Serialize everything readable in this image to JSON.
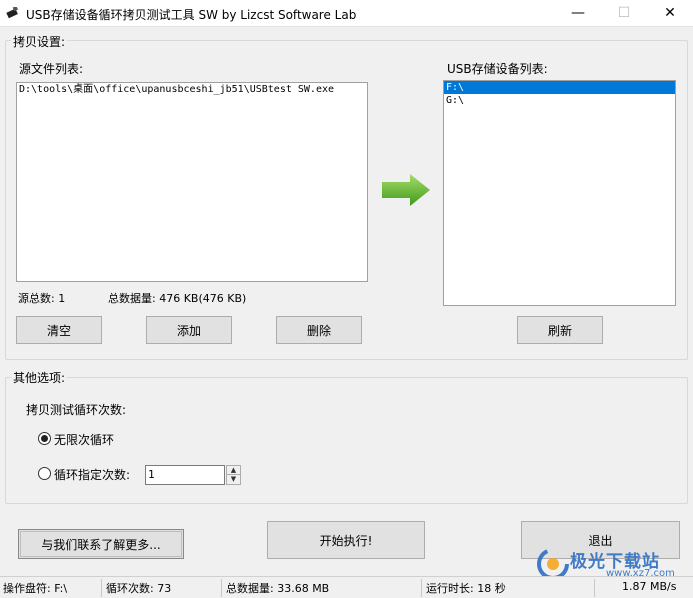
{
  "window": {
    "title": "USB存储设备循环拷贝测试工具 SW  by Lizcst Software Lab",
    "minimize_glyph": "—",
    "maximize_glyph": "☐",
    "close_glyph": "✕"
  },
  "copy_settings": {
    "group_label": "拷贝设置:",
    "source_label": "源文件列表:",
    "source_files": [
      "D:\\tools\\桌面\\office\\upanusbceshi_jb51\\USBtest SW.exe"
    ],
    "source_count": "源总数: 1",
    "total_size": "总数据量: 476 KB(476 KB)",
    "clear_button": "清空",
    "add_button": "添加",
    "delete_button": "删除",
    "usb_label": "USB存储设备列表:",
    "usb_devices": [
      "F:\\",
      "G:\\"
    ],
    "refresh_button": "刷新"
  },
  "other_options": {
    "group_label": "其他选项:",
    "loop_label": "拷贝测试循环次数:",
    "infinite_label": "无限次循环",
    "specified_label": "循环指定次数:",
    "loop_count_value": "1"
  },
  "actions": {
    "contact_button": "与我们联系了解更多...",
    "start_button": "开始执行!",
    "exit_button": "退出"
  },
  "status": {
    "drive": "操作盘符: F:\\",
    "loops": "循环次数: 73",
    "total": "总数据量: 33.68 MB",
    "runtime": "运行时长: 18 秒",
    "speed": "1.87 MB/s"
  },
  "watermark": {
    "text": "极光下载站",
    "url": "www.xz7.com"
  },
  "colors": {
    "selection": "#0078d7",
    "arrow": "#5cb531"
  }
}
